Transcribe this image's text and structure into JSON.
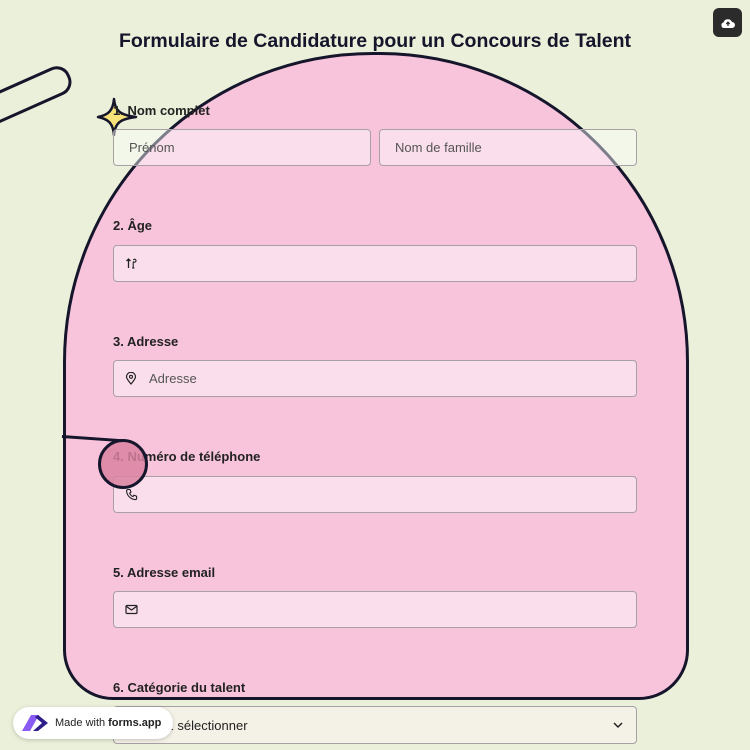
{
  "form": {
    "title": "Formulaire de Candidature pour un Concours de Talent",
    "questions": [
      {
        "label": "1. Nom complet",
        "fields": [
          {
            "placeholder": "Prénom"
          },
          {
            "placeholder": "Nom de famille"
          }
        ]
      },
      {
        "label": "2. Âge",
        "fields": [
          {
            "placeholder": "",
            "icon": "sort-icon"
          }
        ]
      },
      {
        "label": "3. Adresse",
        "fields": [
          {
            "placeholder": "Adresse",
            "icon": "location-pin-icon"
          }
        ]
      },
      {
        "label": "4. Numéro de téléphone",
        "fields": [
          {
            "placeholder": "",
            "icon": "phone-icon"
          }
        ]
      },
      {
        "label": "5. Adresse email",
        "fields": [
          {
            "placeholder": "",
            "icon": "envelope-icon"
          }
        ]
      },
      {
        "label": "6. Catégorie du talent",
        "fields": [
          {
            "value": "Veuillez sélectionner",
            "icon": "chevron-down-icon"
          }
        ]
      }
    ]
  },
  "badge": {
    "made_with": "Made with",
    "brand": "forms.app"
  },
  "colors": {
    "background": "#eaf0d9",
    "arch": "#f8c4dc",
    "outline": "#15152b",
    "star": "#f7e27a"
  }
}
